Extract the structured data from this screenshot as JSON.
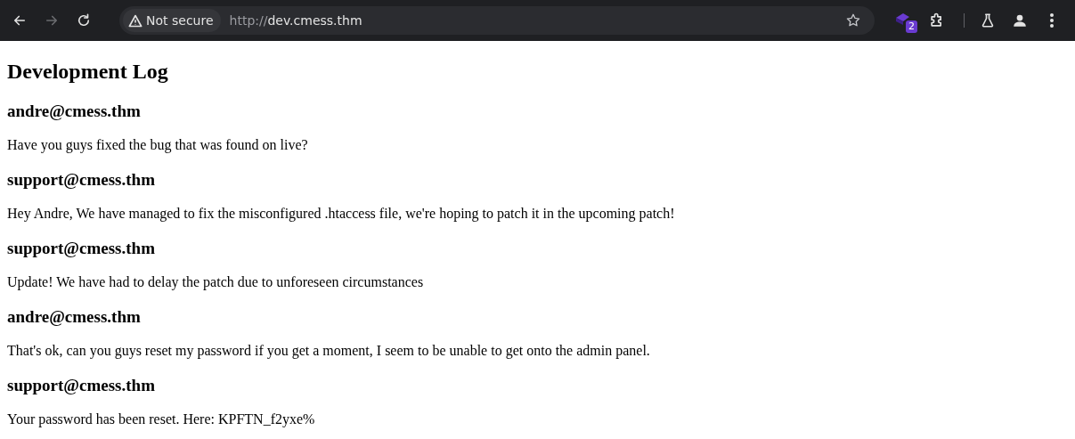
{
  "browser": {
    "back_disabled": false,
    "forward_disabled": true,
    "security_label": "Not secure",
    "url_scheme": "http://",
    "url_host": "dev.cmess.thm",
    "extension_badge": "2"
  },
  "page": {
    "title": "Development Log",
    "posts": [
      {
        "author": "andre@cmess.thm",
        "message": "Have you guys fixed the bug that was found on live?"
      },
      {
        "author": "support@cmess.thm",
        "message": "Hey Andre, We have managed to fix the misconfigured .htaccess file, we're hoping to patch it in the upcoming patch!"
      },
      {
        "author": "support@cmess.thm",
        "message": "Update! We have had to delay the patch due to unforeseen circumstances"
      },
      {
        "author": "andre@cmess.thm",
        "message": "That's ok, can you guys reset my password if you get a moment, I seem to be unable to get onto the admin panel."
      },
      {
        "author": "support@cmess.thm",
        "message": "Your password has been reset. Here: KPFTN_f2yxe%"
      }
    ]
  }
}
